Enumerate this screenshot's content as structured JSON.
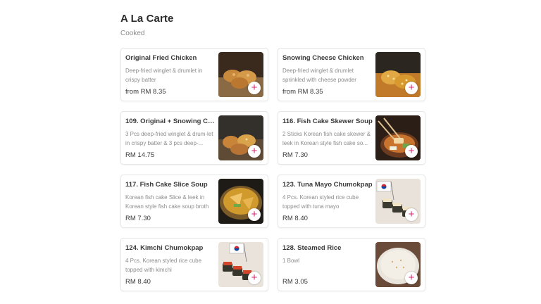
{
  "section": {
    "title": "A La Carte",
    "subtitle": "Cooked"
  },
  "items": [
    {
      "name": "Original Fried Chicken",
      "desc": "Deep-fried winglet & drumlet in crispy batter",
      "price": "from RM 8.35",
      "image": "fried-chicken"
    },
    {
      "name": "Snowing Cheese Chicken",
      "desc": "Deep-fried winglet & drumlet sprinkled with cheese powder",
      "price": "from RM 8.35",
      "image": "cheese-chicken"
    },
    {
      "name": "109. Original + Snowing Ch...",
      "desc": "3 Pcs deep-fried winglet & drum-let in crispy batter & 3 pcs deep-...",
      "price": "RM 14.75",
      "image": "combo-chicken"
    },
    {
      "name": "116. Fish Cake Skewer Soup",
      "desc": "2 Sticks Korean fish cake skewer & leek in Korean style fish cake so...",
      "price": "RM 7.30",
      "image": "fish-cake-skewer-soup"
    },
    {
      "name": "117. Fish Cake Slice Soup",
      "desc": "Korean fish cake Slice & leek in Korean style fish cake soup broth",
      "price": "RM 7.30",
      "image": "fish-cake-slice-soup"
    },
    {
      "name": "123. Tuna Mayo Chumokpap",
      "desc": "4 Pcs. Korean styled rice cube topped with tuna mayo",
      "price": "RM 8.40",
      "image": "tuna-mayo-rice-cubes"
    },
    {
      "name": "124. Kimchi Chumokpap",
      "desc": "4 Pcs. Korean styled rice cube topped with kimchi",
      "price": "RM 8.40",
      "image": "kimchi-rice-cubes"
    },
    {
      "name": "128. Steamed Rice",
      "desc": "1 Bowl",
      "price": "RM 3.05",
      "image": "steamed-rice"
    }
  ],
  "add_button_symbol": "+",
  "colors": {
    "accent": "#d6246e",
    "card_border": "#e6e6e6"
  }
}
